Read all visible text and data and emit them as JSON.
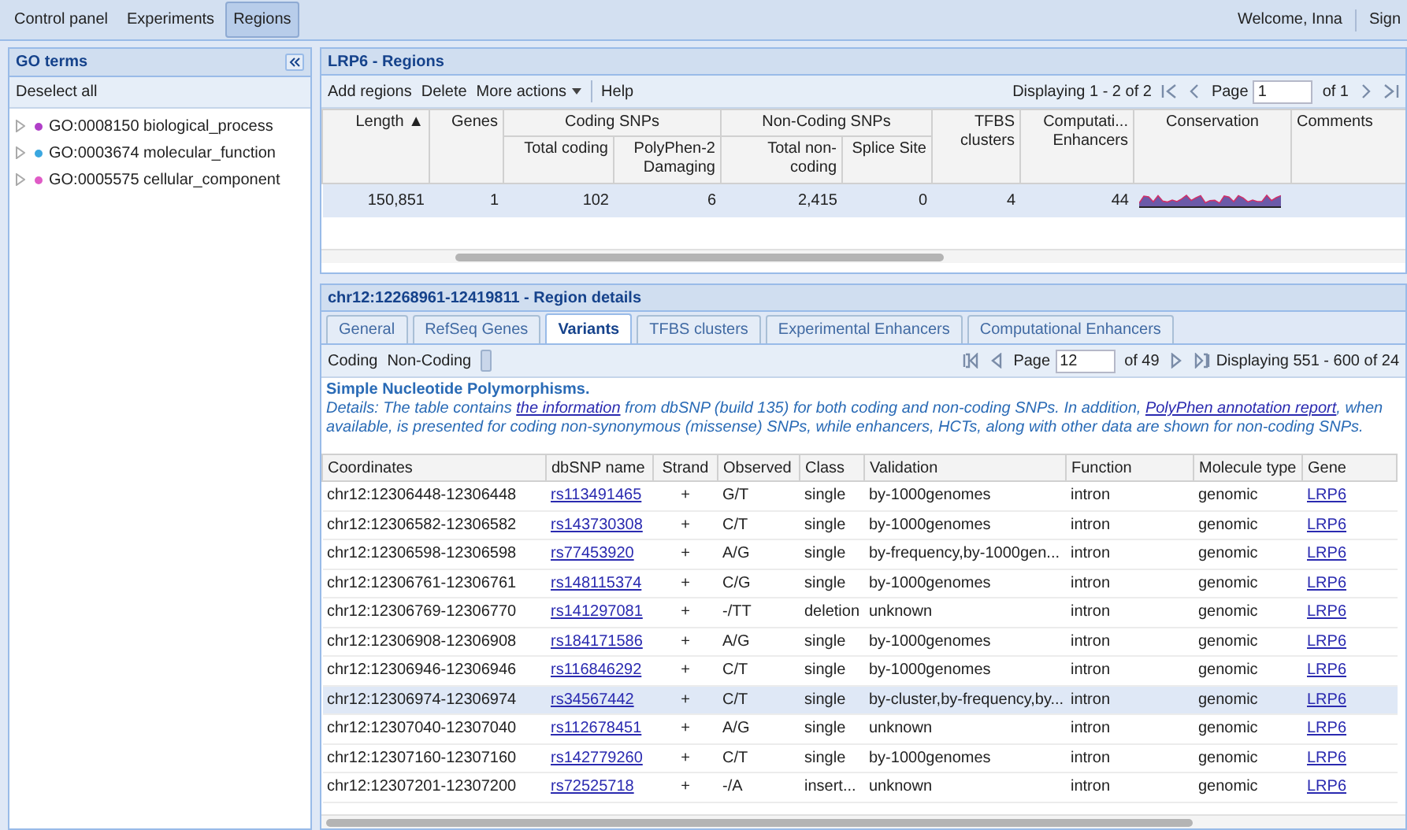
{
  "top_nav": {
    "tabs": [
      {
        "label": "Control panel",
        "selected": false
      },
      {
        "label": "Experiments",
        "selected": false
      },
      {
        "label": "Regions",
        "selected": true
      }
    ],
    "welcome": "Welcome, Inna",
    "sign_out": "Sign"
  },
  "go_panel": {
    "title": "GO terms",
    "deselect": "Deselect all",
    "items": [
      {
        "label": "GO:0008150 biological_process",
        "color": "#b03fc8"
      },
      {
        "label": "GO:0003674 molecular_function",
        "color": "#3aa7e0"
      },
      {
        "label": "GO:0005575 cellular_component",
        "color": "#e05bc6"
      }
    ]
  },
  "regions_panel": {
    "title": "LRP6 - Regions",
    "toolbar": [
      "Add regions",
      "Delete",
      "More actions",
      "Help"
    ],
    "pager": {
      "displaying": "Displaying 1 - 2 of 2",
      "page_label": "Page",
      "page": "1",
      "of": "of 1"
    },
    "columns": [
      {
        "label": "Length ▲",
        "kind": "number"
      },
      {
        "label": "Genes",
        "kind": "number"
      },
      {
        "label": "Coding SNPs",
        "colspan": 2,
        "children": [
          {
            "label": "Total coding"
          },
          {
            "label": "PolyPhen-2 Damaging"
          }
        ]
      },
      {
        "label": "Non-Coding SNPs",
        "colspan": 2,
        "children": [
          {
            "label": "Total non-coding"
          },
          {
            "label": "Splice Site"
          }
        ]
      },
      {
        "label": "TFBS clusters",
        "kind": "number"
      },
      {
        "label": "Computati... Enhancers",
        "kind": "number"
      },
      {
        "label": "Conservation",
        "kind": "picture"
      },
      {
        "label": "Comments",
        "kind": "text"
      }
    ],
    "rows": [
      {
        "selected": true,
        "cells": [
          "150,851",
          "1",
          "102",
          "6",
          "2,415",
          "0",
          "4",
          "44"
        ]
      }
    ]
  },
  "details_panel": {
    "title": "chr12:12268961-12419811 - Region details",
    "tabs": [
      {
        "label": "General",
        "selected": false
      },
      {
        "label": "RefSeq Genes",
        "selected": false
      },
      {
        "label": "Variants",
        "selected": true
      },
      {
        "label": "TFBS clusters",
        "selected": false
      },
      {
        "label": "Experimental Enhancers",
        "selected": false
      },
      {
        "label": "Computational Enhancers",
        "selected": false
      }
    ],
    "toggles": [
      "Coding",
      "Non-Coding"
    ],
    "pager": {
      "page_label": "Page",
      "page": "12",
      "of": "of 49",
      "displaying": "Displaying 551 - 600 of 24"
    },
    "heading": "Simple Nucleotide Polymorphisms.",
    "details": [
      {
        "kind": "text",
        "text": "Details: The table contains "
      },
      {
        "kind": "link",
        "text": "the information"
      },
      {
        "kind": "text",
        "text": " from dbSNP (build 135) for both coding and non-coding SNPs. In addition, "
      },
      {
        "kind": "link",
        "text": "PolyPhen annotation report"
      },
      {
        "kind": "text",
        "text": ", when available, is presented for coding non-synonymous (missense) SNPs, while enhancers, HCTs, along with other data are shown for non-coding SNPs."
      }
    ],
    "columns": [
      {
        "label": "Coordinates"
      },
      {
        "label": "dbSNP name",
        "kind": "link"
      },
      {
        "label": "Strand",
        "kind": "symbol"
      },
      {
        "label": "Observed"
      },
      {
        "label": "Class"
      },
      {
        "label": "Validation"
      },
      {
        "label": "Function"
      },
      {
        "label": "Molecule type"
      },
      {
        "label": "Gene",
        "kind": "link"
      }
    ],
    "rows": [
      {
        "selected": false,
        "cells": [
          "chr12:12306448-12306448",
          "rs113491465",
          "+",
          "G/T",
          "single",
          "by-1000genomes",
          "intron",
          "genomic",
          "LRP6"
        ]
      },
      {
        "selected": false,
        "cells": [
          "chr12:12306582-12306582",
          "rs143730308",
          "+",
          "C/T",
          "single",
          "by-1000genomes",
          "intron",
          "genomic",
          "LRP6"
        ]
      },
      {
        "selected": false,
        "cells": [
          "chr12:12306598-12306598",
          "rs77453920",
          "+",
          "A/G",
          "single",
          "by-frequency,by-1000gen...",
          "intron",
          "genomic",
          "LRP6"
        ]
      },
      {
        "selected": false,
        "cells": [
          "chr12:12306761-12306761",
          "rs148115374",
          "+",
          "C/G",
          "single",
          "by-1000genomes",
          "intron",
          "genomic",
          "LRP6"
        ]
      },
      {
        "selected": false,
        "cells": [
          "chr12:12306769-12306770",
          "rs141297081",
          "+",
          "-/TT",
          "deletion",
          "unknown",
          "intron",
          "genomic",
          "LRP6"
        ]
      },
      {
        "selected": false,
        "cells": [
          "chr12:12306908-12306908",
          "rs184171586",
          "+",
          "A/G",
          "single",
          "by-1000genomes",
          "intron",
          "genomic",
          "LRP6"
        ]
      },
      {
        "selected": false,
        "cells": [
          "chr12:12306946-12306946",
          "rs116846292",
          "+",
          "C/T",
          "single",
          "by-1000genomes",
          "intron",
          "genomic",
          "LRP6"
        ]
      },
      {
        "selected": true,
        "cells": [
          "chr12:12306974-12306974",
          "rs34567442",
          "+",
          "C/T",
          "single",
          "by-cluster,by-frequency,by...",
          "intron",
          "genomic",
          "LRP6"
        ]
      },
      {
        "selected": false,
        "cells": [
          "chr12:12307040-12307040",
          "rs112678451",
          "+",
          "A/G",
          "single",
          "unknown",
          "intron",
          "genomic",
          "LRP6"
        ]
      },
      {
        "selected": false,
        "cells": [
          "chr12:12307160-12307160",
          "rs142779260",
          "+",
          "C/T",
          "single",
          "by-1000genomes",
          "intron",
          "genomic",
          "LRP6"
        ]
      },
      {
        "selected": false,
        "cells": [
          "chr12:12307201-12307200",
          "rs72525718",
          "+",
          "-/A",
          "insert...",
          "unknown",
          "intron",
          "genomic",
          "LRP6"
        ]
      }
    ]
  }
}
